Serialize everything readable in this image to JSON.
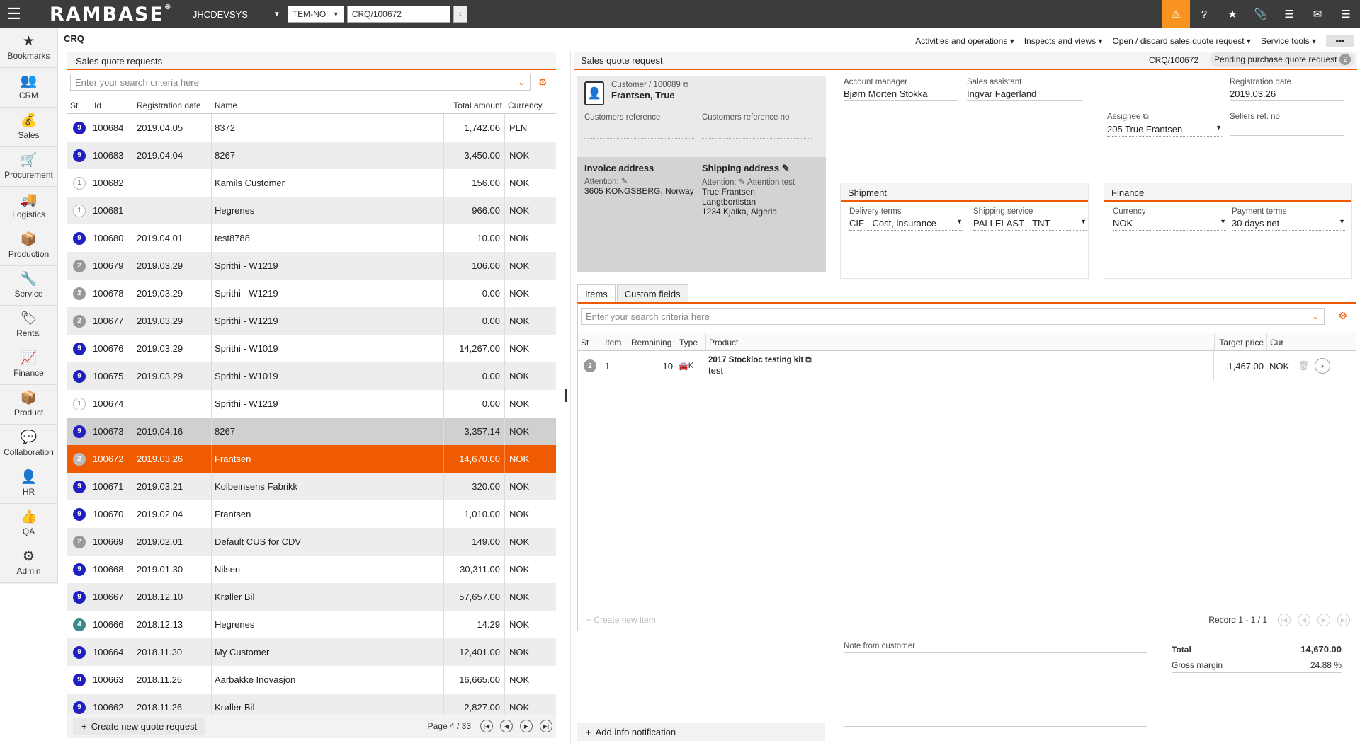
{
  "topbar": {
    "logo": "RAMBASE",
    "logo_mark": "®",
    "system": "JHCDEVSYS",
    "company": "TEM-NO",
    "doc_input": "CRQ/100672",
    "accent": "#f7931e"
  },
  "nav": [
    {
      "label": "Bookmarks",
      "icon": "★"
    },
    {
      "label": "CRM",
      "icon": "👥"
    },
    {
      "label": "Sales",
      "icon": "💰"
    },
    {
      "label": "Procurement",
      "icon": "🛒"
    },
    {
      "label": "Logistics",
      "icon": "🚚"
    },
    {
      "label": "Production",
      "icon": "📦"
    },
    {
      "label": "Service",
      "icon": "🔧"
    },
    {
      "label": "Rental",
      "icon": "🏷"
    },
    {
      "label": "Finance",
      "icon": "📈"
    },
    {
      "label": "Product",
      "icon": "📦"
    },
    {
      "label": "Collaboration",
      "icon": "💬"
    },
    {
      "label": "HR",
      "icon": "👤"
    },
    {
      "label": "QA",
      "icon": "👍"
    },
    {
      "label": "Admin",
      "icon": "⚙"
    }
  ],
  "page": {
    "title": "CRQ"
  },
  "left": {
    "header": "Sales quote requests",
    "search_placeholder": "Enter your search criteria here",
    "columns": [
      "St",
      "Id",
      "Registration date",
      "Name",
      "Total amount",
      "Currency"
    ],
    "rows": [
      {
        "st": "9",
        "id": "100684",
        "date": "2019.04.05",
        "name": "8372",
        "amount": "1,742.06",
        "cur": "PLN"
      },
      {
        "st": "9",
        "id": "100683",
        "date": "2019.04.04",
        "name": "8267",
        "amount": "3,450.00",
        "cur": "NOK"
      },
      {
        "st": "1",
        "id": "100682",
        "date": "",
        "name": "Kamils Customer",
        "amount": "156.00",
        "cur": "NOK"
      },
      {
        "st": "1",
        "id": "100681",
        "date": "",
        "name": "Hegrenes",
        "amount": "966.00",
        "cur": "NOK"
      },
      {
        "st": "9",
        "id": "100680",
        "date": "2019.04.01",
        "name": "test8788",
        "amount": "10.00",
        "cur": "NOK"
      },
      {
        "st": "2",
        "id": "100679",
        "date": "2019.03.29",
        "name": "Sprithi - W1219",
        "amount": "106.00",
        "cur": "NOK"
      },
      {
        "st": "2",
        "id": "100678",
        "date": "2019.03.29",
        "name": "Sprithi - W1219",
        "amount": "0.00",
        "cur": "NOK"
      },
      {
        "st": "2",
        "id": "100677",
        "date": "2019.03.29",
        "name": "Sprithi - W1219",
        "amount": "0.00",
        "cur": "NOK"
      },
      {
        "st": "9",
        "id": "100676",
        "date": "2019.03.29",
        "name": "Sprithi - W1019",
        "amount": "14,267.00",
        "cur": "NOK"
      },
      {
        "st": "9",
        "id": "100675",
        "date": "2019.03.29",
        "name": "Sprithi - W1019",
        "amount": "0.00",
        "cur": "NOK"
      },
      {
        "st": "1",
        "id": "100674",
        "date": "",
        "name": "Sprithi - W1219",
        "amount": "0.00",
        "cur": "NOK"
      },
      {
        "st": "9",
        "id": "100673",
        "date": "2019.04.16",
        "name": "8267",
        "amount": "3,357.14",
        "cur": "NOK"
      },
      {
        "st": "2",
        "id": "100672",
        "date": "2019.03.26",
        "name": "Frantsen",
        "amount": "14,670.00",
        "cur": "NOK"
      },
      {
        "st": "9",
        "id": "100671",
        "date": "2019.03.21",
        "name": "Kolbeinsens Fabrikk",
        "amount": "320.00",
        "cur": "NOK"
      },
      {
        "st": "9",
        "id": "100670",
        "date": "2019.02.04",
        "name": "Frantsen",
        "amount": "1,010.00",
        "cur": "NOK"
      },
      {
        "st": "2",
        "id": "100669",
        "date": "2019.02.01",
        "name": "Default CUS for CDV",
        "amount": "149.00",
        "cur": "NOK"
      },
      {
        "st": "9",
        "id": "100668",
        "date": "2019.01.30",
        "name": "Nilsen",
        "amount": "30,311.00",
        "cur": "NOK"
      },
      {
        "st": "9",
        "id": "100667",
        "date": "2018.12.10",
        "name": "Krøller Bil",
        "amount": "57,657.00",
        "cur": "NOK"
      },
      {
        "st": "4",
        "id": "100666",
        "date": "2018.12.13",
        "name": "Hegrenes",
        "amount": "14.29",
        "cur": "NOK"
      },
      {
        "st": "9",
        "id": "100664",
        "date": "2018.11.30",
        "name": "My Customer",
        "amount": "12,401.00",
        "cur": "NOK"
      },
      {
        "st": "9",
        "id": "100663",
        "date": "2018.11.26",
        "name": "Aarbakke Inovasjon",
        "amount": "16,665.00",
        "cur": "NOK"
      },
      {
        "st": "9",
        "id": "100662",
        "date": "2018.11.26",
        "name": "Krøller Bil",
        "amount": "2,827.00",
        "cur": "NOK"
      }
    ],
    "create_label": "Create new quote request",
    "page_label": "Page 4 / 33"
  },
  "right": {
    "actions": [
      "Activities and operations ▾",
      "Inspects and views ▾",
      "Open / discard sales quote request ▾",
      "Service tools ▾"
    ],
    "more": "•••",
    "header": "Sales quote request",
    "doc_id": "CRQ/100672",
    "status": "Pending purchase quote request",
    "status_num": "2",
    "customer": {
      "label": "Customer / 100089",
      "name": "Frantsen, True",
      "cust_ref_label": "Customers reference",
      "cust_ref_no_label": "Customers reference no",
      "invoice_label": "Invoice address",
      "invoice_attention": "Attention:",
      "invoice_addr": "3605 KONGSBERG, Norway",
      "shipping_label": "Shipping address",
      "shipping_attention": "Attention:",
      "shipping_attention_val": "Attention test",
      "ship_line1": "True Frantsen",
      "ship_line2": "Langtbortistan",
      "ship_line3": "1234 Kjalka, Algeria"
    },
    "fields": {
      "account_manager_label": "Account manager",
      "account_manager": "Bjørn Morten Stokka",
      "sales_assistant_label": "Sales assistant",
      "sales_assistant": "Ingvar Fagerland",
      "reg_date_label": "Registration date",
      "reg_date": "2019.03.26",
      "assignee_label": "Assignee",
      "assignee": "205 True  Frantsen",
      "sellers_ref_label": "Sellers ref. no"
    },
    "shipment": {
      "header": "Shipment",
      "delivery_label": "Delivery terms",
      "delivery": "CIF - Cost, insurance",
      "service_label": "Shipping service",
      "service": "PALLELAST - TNT"
    },
    "finance": {
      "header": "Finance",
      "currency_label": "Currency",
      "currency": "NOK",
      "payment_label": "Payment terms",
      "payment": "30 days net"
    },
    "tabs": [
      "Items",
      "Custom fields"
    ],
    "items": {
      "search_placeholder": "Enter your search criteria here",
      "columns": [
        "St",
        "Item",
        "Remaining",
        "Type",
        "Product",
        "Target price",
        "Cur"
      ],
      "row": {
        "st": "2",
        "item": "1",
        "remaining": "10",
        "type": "K",
        "product": "2017 Stockloc testing kit",
        "desc": "test",
        "price": "1,467.00",
        "cur": "NOK"
      },
      "create_label": "Create new item",
      "record": "Record 1 - 1 / 1"
    },
    "info_label": "Add info notification",
    "note_label": "Note from customer",
    "total_label": "Total",
    "total": "14,670.00",
    "margin_label": "Gross margin",
    "margin": "24.88 %"
  }
}
